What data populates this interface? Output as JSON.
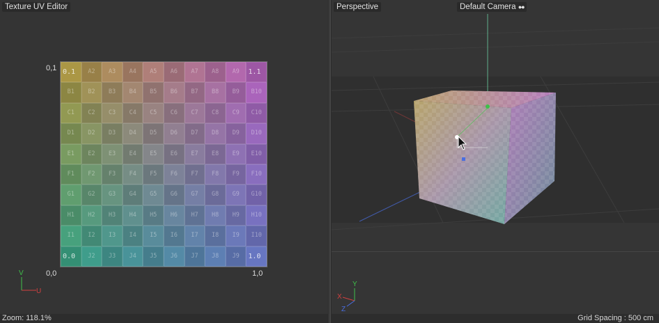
{
  "uv_editor": {
    "title": "Texture UV Editor",
    "zoom": "Zoom: 118.1%",
    "corner_labels": {
      "top_left": "0,1",
      "bottom_left": "0,0",
      "bottom_right": "1,0"
    },
    "axis": {
      "v": "V",
      "u": "U"
    },
    "grid_rows": [
      [
        "0.1",
        "A2",
        "A3",
        "A4",
        "A5",
        "A6",
        "A7",
        "A8",
        "A9",
        "1.1"
      ],
      [
        "B1",
        "B2",
        "B3",
        "B4",
        "B5",
        "B6",
        "B7",
        "B8",
        "B9",
        "B10"
      ],
      [
        "C1",
        "C2",
        "C3",
        "C4",
        "C5",
        "C6",
        "C7",
        "C8",
        "C9",
        "C10"
      ],
      [
        "D1",
        "D2",
        "D3",
        "D4",
        "D5",
        "D6",
        "D7",
        "D8",
        "D9",
        "D10"
      ],
      [
        "E1",
        "E2",
        "E3",
        "E4",
        "E5",
        "E6",
        "E7",
        "E8",
        "E9",
        "E10"
      ],
      [
        "F1",
        "F2",
        "F3",
        "F4",
        "F5",
        "F6",
        "F7",
        "F8",
        "F9",
        "F10"
      ],
      [
        "G1",
        "G2",
        "G3",
        "G4",
        "G5",
        "G6",
        "G7",
        "G8",
        "G9",
        "G10"
      ],
      [
        "H1",
        "H2",
        "H3",
        "H4",
        "H5",
        "H6",
        "H7",
        "H8",
        "H9",
        "H10"
      ],
      [
        "I1",
        "I2",
        "I3",
        "I4",
        "I5",
        "I6",
        "I7",
        "I8",
        "I9",
        "I10"
      ],
      [
        "0.0",
        "J2",
        "J3",
        "J4",
        "J5",
        "J6",
        "J7",
        "J8",
        "J9",
        "1.0"
      ]
    ],
    "corner_colors": {
      "tl": "#b8a24a",
      "tr": "#c06ac8",
      "bl": "#3fae8e",
      "br": "#6f7fd0"
    }
  },
  "perspective": {
    "title": "Perspective",
    "camera": "Default Camera",
    "camera_icon": "camera-dots-icon",
    "grid_spacing": "Grid Spacing : 500 cm",
    "axis": {
      "x": "X",
      "y": "Y",
      "z": "Z"
    }
  },
  "colors": {
    "axis_x": "#d24040",
    "axis_y": "#3fbf4a",
    "axis_z": "#4a6ee0"
  }
}
